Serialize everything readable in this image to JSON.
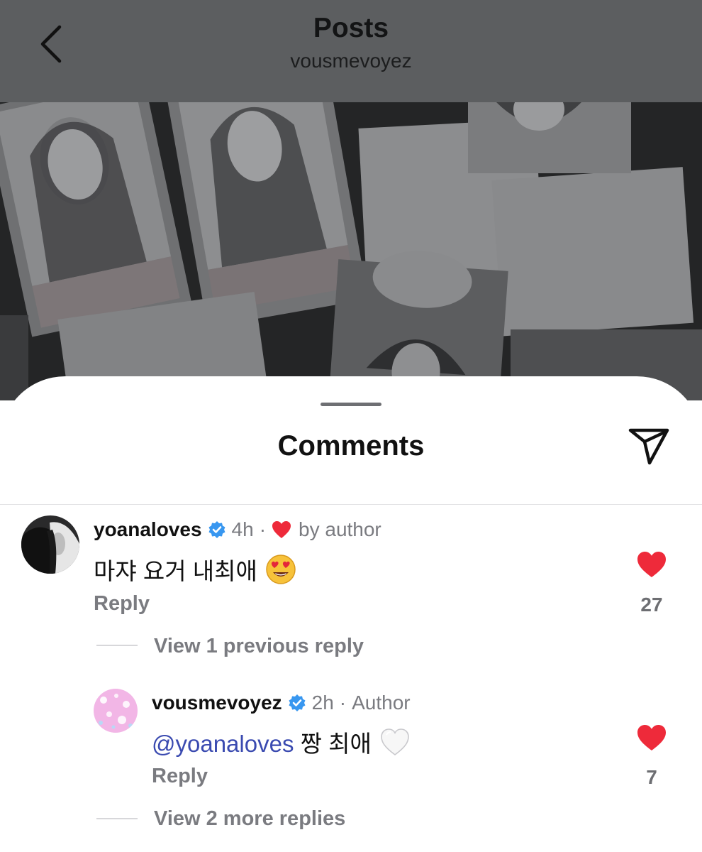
{
  "header": {
    "title": "Posts",
    "subtitle": "vousmevoyez"
  },
  "sheet": {
    "title": "Comments"
  },
  "comments": [
    {
      "username": "yoanaloves",
      "verified": true,
      "time": "4h",
      "separator": "·",
      "liked_by_author_label": "by author",
      "text": "마쟈 요거 내최애",
      "emoji": "smiling-face-with-heart-eyes",
      "reply_label": "Reply",
      "likes": "27",
      "liked": true,
      "view_previous_label": "View 1 previous reply"
    }
  ],
  "replies": [
    {
      "username": "vousmevoyez",
      "verified": true,
      "time": "2h",
      "separator": "·",
      "role": "Author",
      "mention": "@yoanaloves",
      "text": " 짱 최애",
      "emoji": "white-heart",
      "reply_label": "Reply",
      "likes": "7",
      "liked": true,
      "view_more_label": "View 2 more replies"
    }
  ],
  "colors": {
    "like_red": "#ee2a3a",
    "verified_blue": "#3897f0",
    "mention_blue": "#3a4ab0",
    "muted_text": "#7a7b80"
  },
  "icons": [
    "back-chevron-icon",
    "share-icon",
    "verified-badge-icon",
    "heart-icon"
  ]
}
